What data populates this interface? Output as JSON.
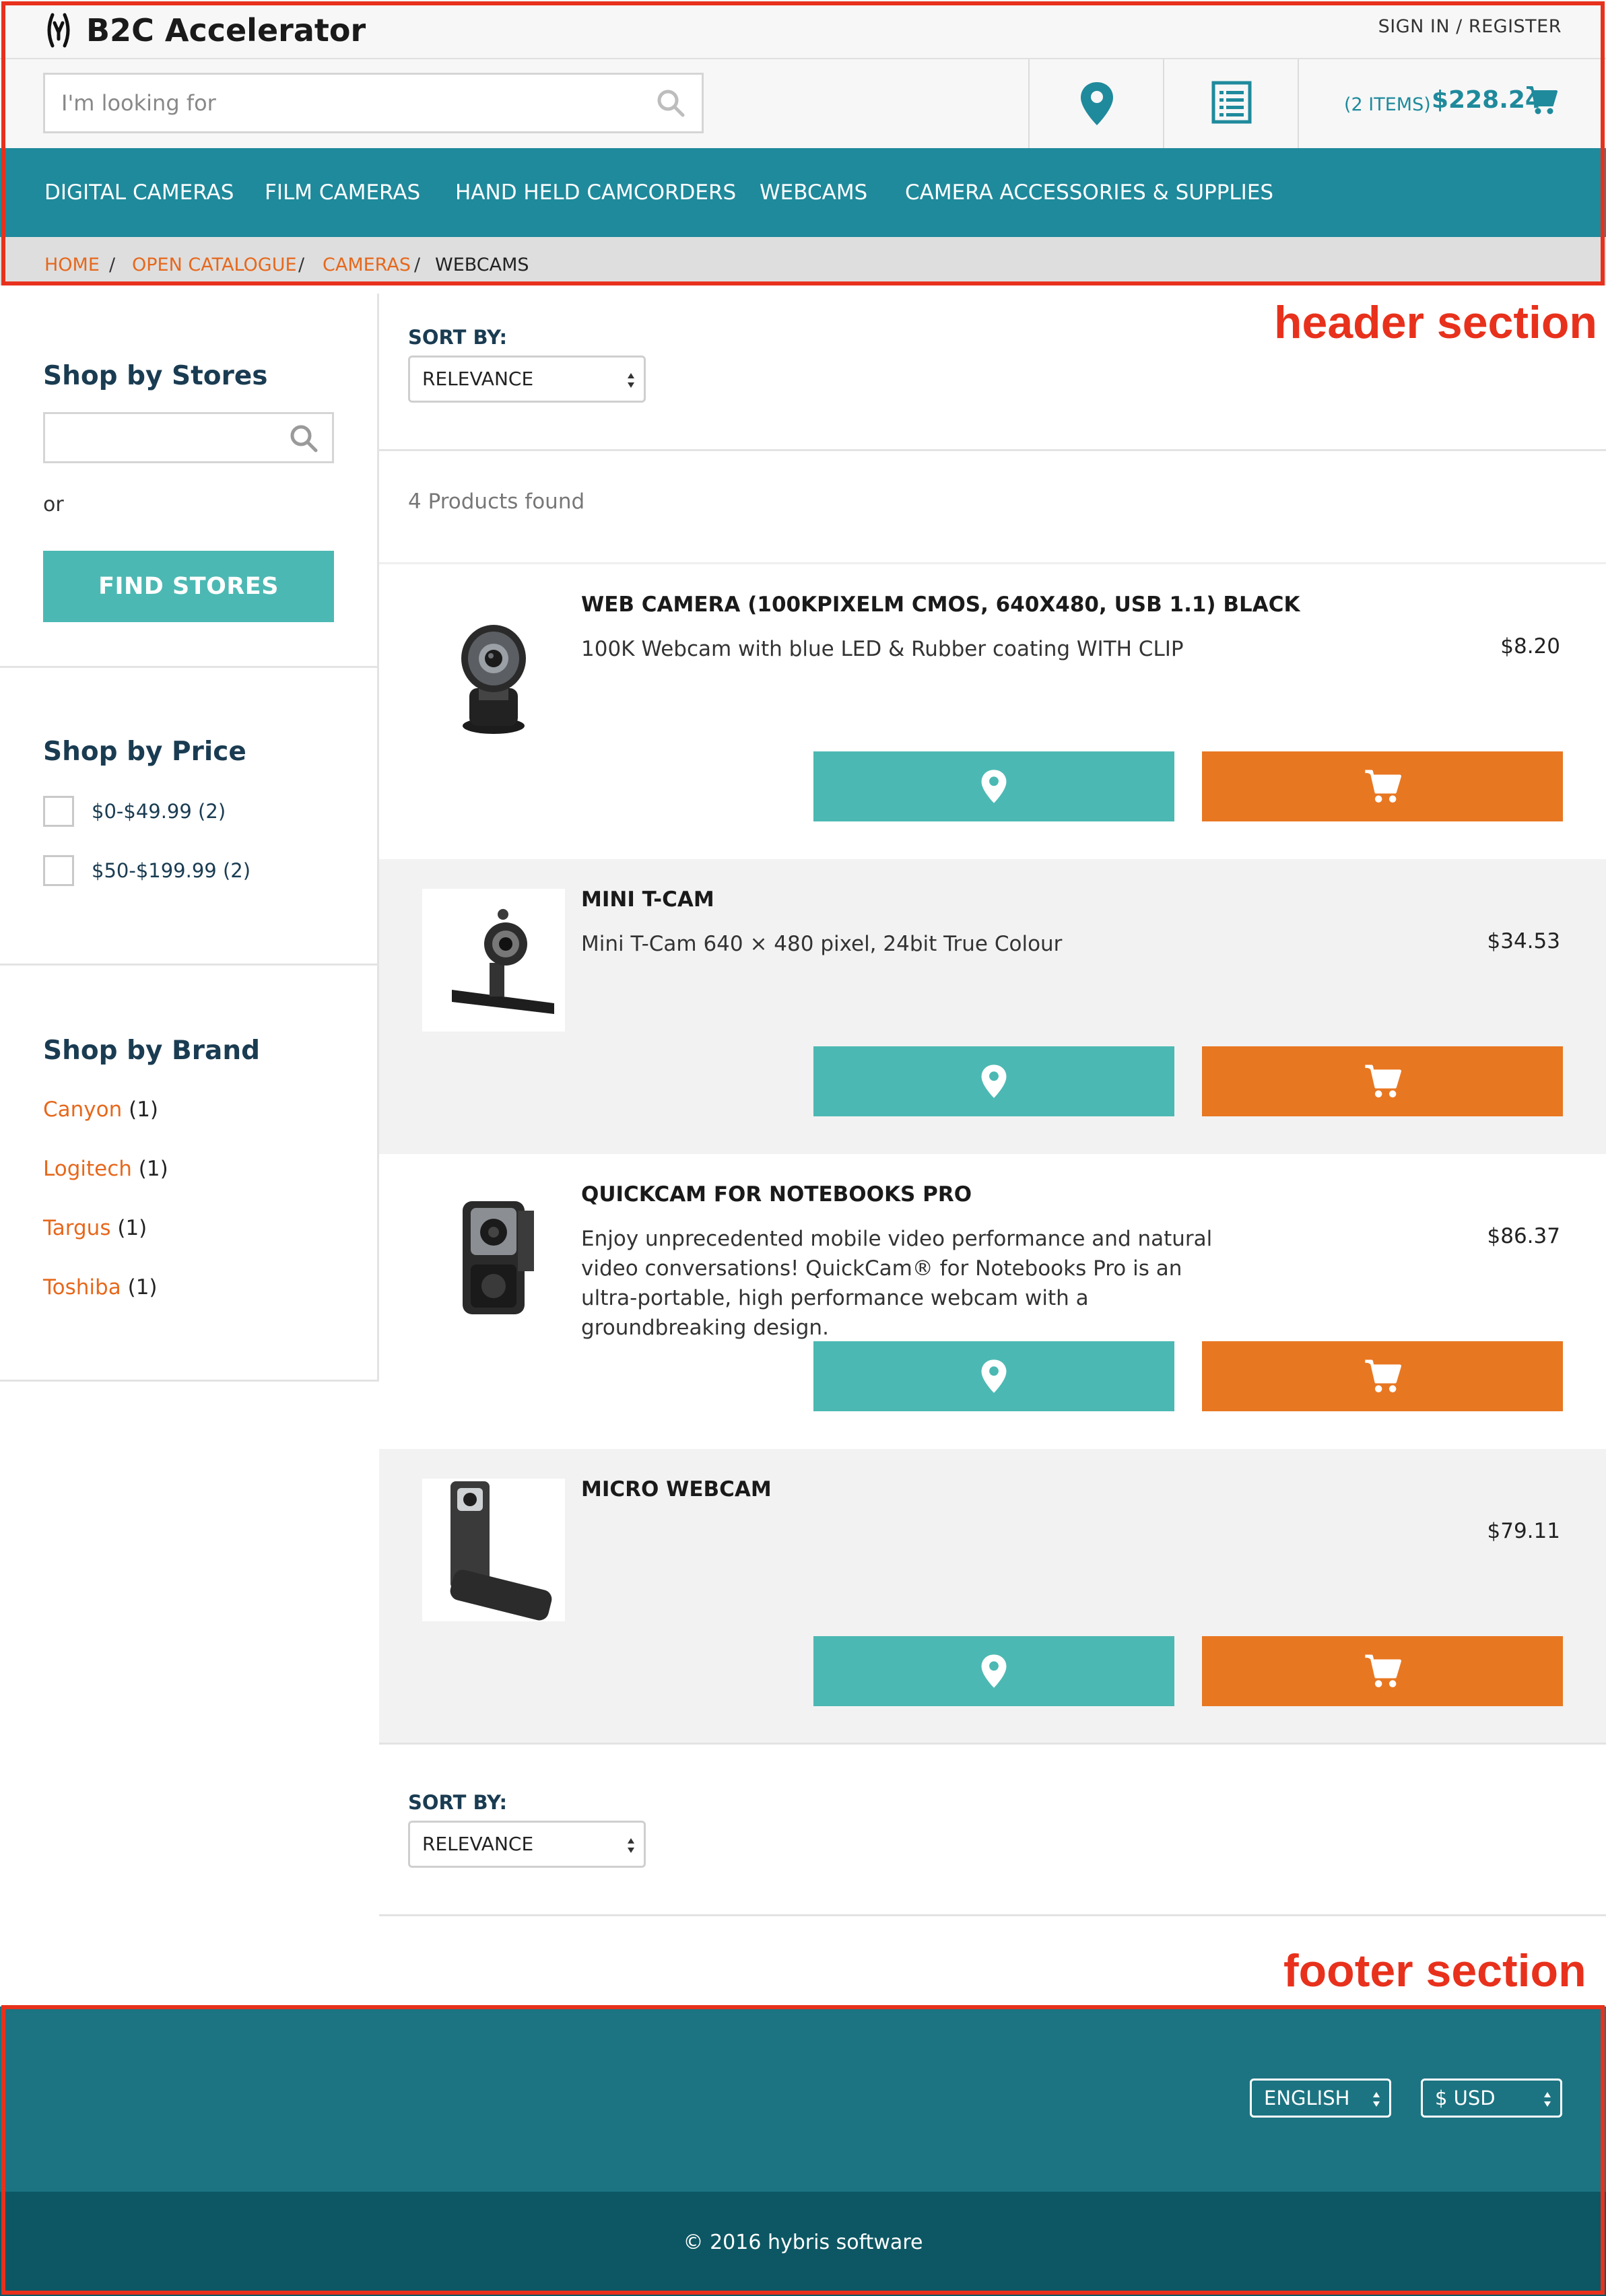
{
  "header": {
    "logo_text": "B2C Accelerator",
    "signin_label": "SIGN IN / REGISTER",
    "search_placeholder": "I'm looking for",
    "cart_count": "(2 ITEMS)",
    "cart_total": "$228.24"
  },
  "nav": {
    "items": [
      "DIGITAL CAMERAS",
      "FILM CAMERAS",
      "HAND HELD CAMCORDERS",
      "WEBCAMS",
      "CAMERA ACCESSORIES & SUPPLIES"
    ]
  },
  "breadcrumb": {
    "items": [
      "HOME",
      "OPEN CATALOGUE",
      "CAMERAS"
    ],
    "separator": "/",
    "current": "WEBCAMS"
  },
  "sidebar": {
    "stores_title": "Shop by Stores",
    "or_text": "or",
    "find_stores_label": "FIND STORES",
    "price_title": "Shop by Price",
    "price_options": [
      "$0-$49.99  (2)",
      "$50-$199.99  (2)"
    ],
    "brand_title": "Shop by Brand",
    "brands": [
      {
        "name": "Canyon",
        "count": "(1)"
      },
      {
        "name": "Logitech",
        "count": "(1)"
      },
      {
        "name": "Targus",
        "count": "(1)"
      },
      {
        "name": "Toshiba",
        "count": "(1)"
      }
    ]
  },
  "main": {
    "sort_label": "SORT BY:",
    "sort_value": "RELEVANCE",
    "results_text": "4 Products found",
    "products": [
      {
        "name": "WEB CAMERA (100KPIXELM CMOS, 640X480, USB 1.1) BLACK",
        "description": "100K Webcam with blue LED & Rubber coating WITH CLIP",
        "price": "$8.20"
      },
      {
        "name": "MINI T-CAM",
        "description": "Mini T-Cam 640 × 480 pixel, 24bit True Colour",
        "price": "$34.53"
      },
      {
        "name": "QUICKCAM FOR NOTEBOOKS PRO",
        "description": "Enjoy unprecedented mobile video performance and natural video conversations! QuickCam® for Notebooks Pro is an ultra-portable, high performance webcam with a groundbreaking design.",
        "price": "$86.37"
      },
      {
        "name": "MICRO WEBCAM",
        "description": "",
        "price": "$79.11"
      }
    ]
  },
  "footer": {
    "language": "ENGLISH",
    "currency": "$ USD",
    "copyright": "© 2016 hybris software"
  },
  "annotations": {
    "header_label": "header section",
    "footer_label": "footer section"
  },
  "colors": {
    "primary_teal": "#1f8a9c",
    "button_teal": "#4cb8b3",
    "cart_orange": "#e87722",
    "link_orange": "#e6681c",
    "footer_top": "#1c7482",
    "footer_bottom": "#0d5764",
    "annotation_red": "#e8311c"
  },
  "icons": [
    "logo-icon",
    "search-icon",
    "location-pin-icon",
    "list-icon",
    "cart-icon",
    "select-arrows-icon",
    "product-image"
  ]
}
